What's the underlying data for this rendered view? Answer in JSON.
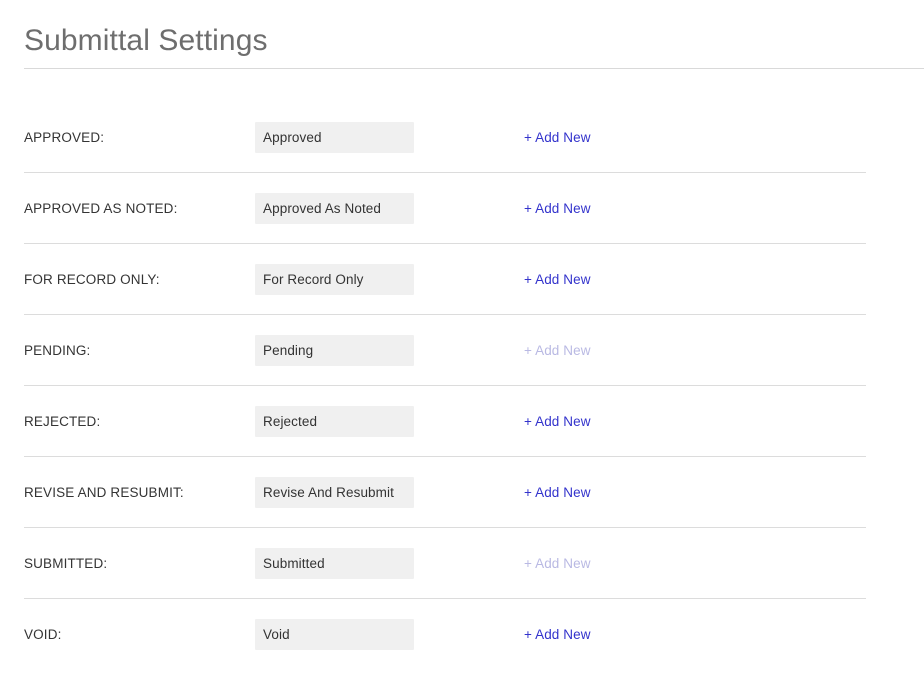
{
  "header": {
    "title": "Submittal Settings"
  },
  "rows": [
    {
      "label": "APPROVED:",
      "value": "Approved",
      "action_label": "+ Add New",
      "action_enabled": true
    },
    {
      "label": "APPROVED AS NOTED:",
      "value": "Approved As Noted",
      "action_label": "+ Add New",
      "action_enabled": true
    },
    {
      "label": "FOR RECORD ONLY:",
      "value": "For Record Only",
      "action_label": "+ Add New",
      "action_enabled": true
    },
    {
      "label": "PENDING:",
      "value": "Pending",
      "action_label": "+ Add New",
      "action_enabled": false
    },
    {
      "label": "REJECTED:",
      "value": "Rejected",
      "action_label": "+ Add New",
      "action_enabled": true
    },
    {
      "label": "REVISE AND RESUBMIT:",
      "value": "Revise And Resubmit",
      "action_label": "+ Add New",
      "action_enabled": true
    },
    {
      "label": "SUBMITTED:",
      "value": "Submitted",
      "action_label": "+ Add New",
      "action_enabled": false
    },
    {
      "label": "VOID:",
      "value": "Void",
      "action_label": "+ Add New",
      "action_enabled": true
    }
  ],
  "colors": {
    "page_background": "#ffffff",
    "title_text": "#6e6e6e",
    "label_text": "#343434",
    "input_background": "#f0f0f0",
    "input_text": "#333333",
    "link_active": "#3333cc",
    "link_disabled": "#b9b9e3",
    "divider": "#dcdcdc",
    "header_divider": "#d9d9d9"
  }
}
